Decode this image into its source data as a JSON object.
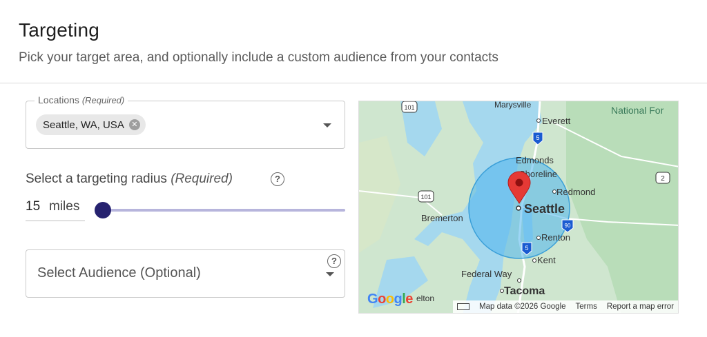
{
  "header": {
    "title": "Targeting",
    "subtitle": "Pick your target area, and optionally include a custom audience from your contacts"
  },
  "locations": {
    "label": "Locations",
    "required": "(Required)",
    "chip": "Seattle, WA, USA",
    "chip_remove_icon": "x-circle-icon"
  },
  "radius": {
    "label": "Select a targeting radius",
    "required": "(Required)",
    "help_icon": "?",
    "value": "15",
    "unit": "miles",
    "slider_fraction": 0.0
  },
  "audience": {
    "placeholder": "Select Audience (Optional)",
    "help_icon": "?"
  },
  "map": {
    "labels": {
      "marysville": "Marysville",
      "everett": "Everett",
      "edmonds": "Edmonds",
      "shoreline": "Shoreline",
      "redmond": "Redmond",
      "seattle": "Seattle",
      "bremerton": "Bremerton",
      "renton": "Renton",
      "kent": "Kent",
      "federal_way": "Federal Way",
      "tacoma": "Tacoma",
      "national_forest": "National For",
      "lelton": "elton"
    },
    "shields": {
      "us101_top": "101",
      "us101_left": "101",
      "i5_top": "5",
      "i5_bottom": "5",
      "us2": "2",
      "i90": "90"
    },
    "attribution": {
      "google": "Google",
      "map_data": "Map data ©2026 Google",
      "terms": "Terms",
      "report": "Report a map error"
    },
    "colors": {
      "water": "#a5d8ee",
      "land": "#cfe6cf",
      "forest": "#b6dcb6",
      "radius_fill": "#4fb5ee",
      "pin": "#e53935"
    }
  }
}
